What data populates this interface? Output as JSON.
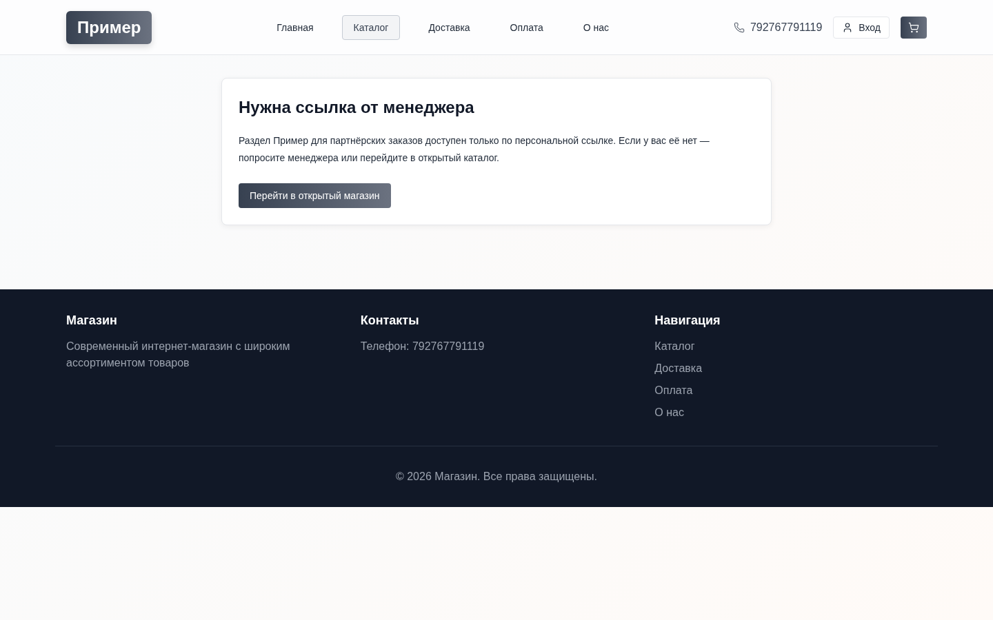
{
  "header": {
    "logo": "Пример",
    "nav": [
      {
        "label": "Главная",
        "selected": false
      },
      {
        "label": "Каталог",
        "selected": true
      },
      {
        "label": "Доставка",
        "selected": false
      },
      {
        "label": "Оплата",
        "selected": false
      },
      {
        "label": "О нас",
        "selected": false
      }
    ],
    "phone": "792767791119",
    "login_button": "Вход"
  },
  "notice": {
    "title": "Нужна ссылка от менеджера",
    "text": "Раздел Пример для партнёрских заказов доступен только по персональной ссылке. Если у вас её нет — попросите менеджера или перейдите в открытый каталог.",
    "button": "Перейти в открытый магазин"
  },
  "footer": {
    "shop": {
      "title": "Магазин",
      "text": "Современный интернет-магазин с широким ассортиментом товаров"
    },
    "contacts": {
      "title": "Контакты",
      "phone": "Телефон: 792767791119"
    },
    "navigation": {
      "title": "Навигация",
      "links": [
        "Каталог",
        "Доставка",
        "Оплата",
        "О нас"
      ]
    },
    "copyright": "© 2026 Магазин. Все права защищены."
  }
}
